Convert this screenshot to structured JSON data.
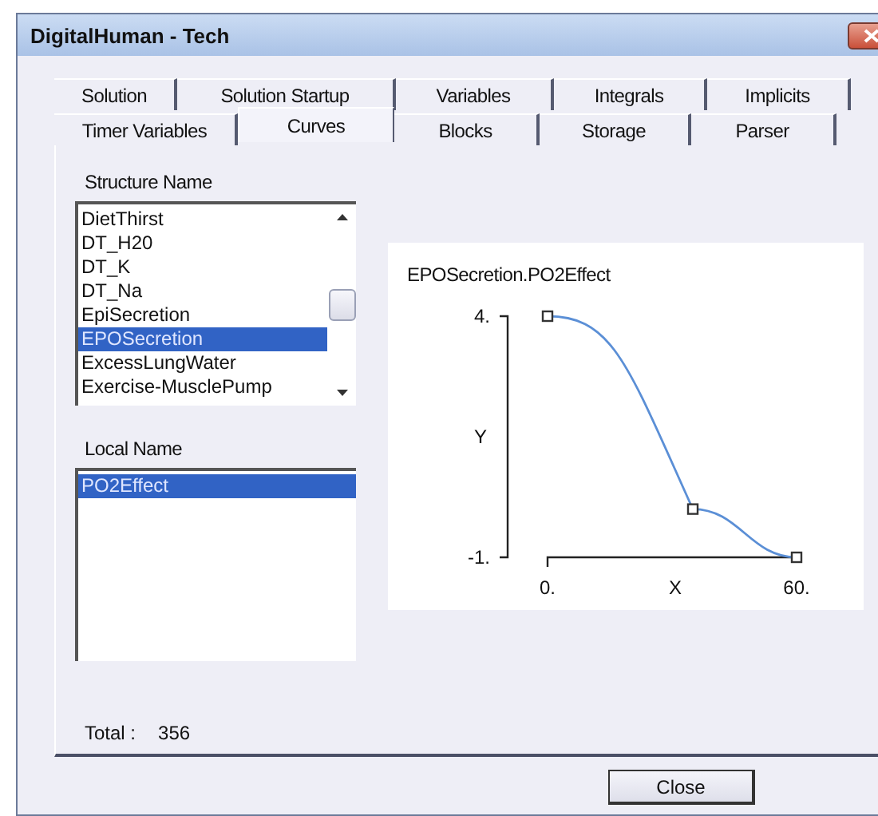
{
  "window": {
    "title": "DigitalHuman - Tech"
  },
  "tab_rows": [
    [
      {
        "label": "Solution",
        "selected": false
      },
      {
        "label": "Solution Startup",
        "selected": false
      },
      {
        "label": "Variables",
        "selected": false
      },
      {
        "label": "Integrals",
        "selected": false
      },
      {
        "label": "Implicits",
        "selected": false
      }
    ],
    [
      {
        "label": "Timer Variables",
        "selected": false
      },
      {
        "label": "Curves",
        "selected": true
      },
      {
        "label": "Blocks",
        "selected": false
      },
      {
        "label": "Storage",
        "selected": false
      },
      {
        "label": "Parser",
        "selected": false
      }
    ]
  ],
  "structure_list": {
    "label": "Structure Name",
    "items": [
      {
        "text": "DietThirst",
        "selected": false
      },
      {
        "text": "DT_H20",
        "selected": false
      },
      {
        "text": "DT_K",
        "selected": false
      },
      {
        "text": "DT_Na",
        "selected": false
      },
      {
        "text": "EpiSecretion",
        "selected": false
      },
      {
        "text": "EPOSecretion",
        "selected": true
      },
      {
        "text": "ExcessLungWater",
        "selected": false
      },
      {
        "text": "Exercise-MusclePump",
        "selected": false
      }
    ]
  },
  "local_list": {
    "label": "Local Name",
    "items": [
      {
        "text": "PO2Effect",
        "selected": true
      }
    ]
  },
  "total": {
    "label": "Total :",
    "value": "356"
  },
  "curve": {
    "chart_data": {
      "type": "line",
      "title": "EPOSecretion.PO2Effect",
      "xlabel": "X",
      "ylabel": "Y",
      "x": [
        0,
        35,
        60
      ],
      "series": [
        {
          "color": "#5b8fd6",
          "marker": "square",
          "values": [
            4,
            0,
            -1
          ]
        }
      ],
      "xlim": [
        0,
        60
      ],
      "ylim": [
        -1,
        4
      ],
      "xticks": [
        {
          "value": 0,
          "label": "0."
        },
        {
          "value": 60,
          "label": "60."
        }
      ],
      "yticks": [
        {
          "value": -1,
          "label": "-1."
        },
        {
          "value": 4,
          "label": "4."
        }
      ]
    }
  },
  "buttons": [
    {
      "label": "Close"
    }
  ]
}
